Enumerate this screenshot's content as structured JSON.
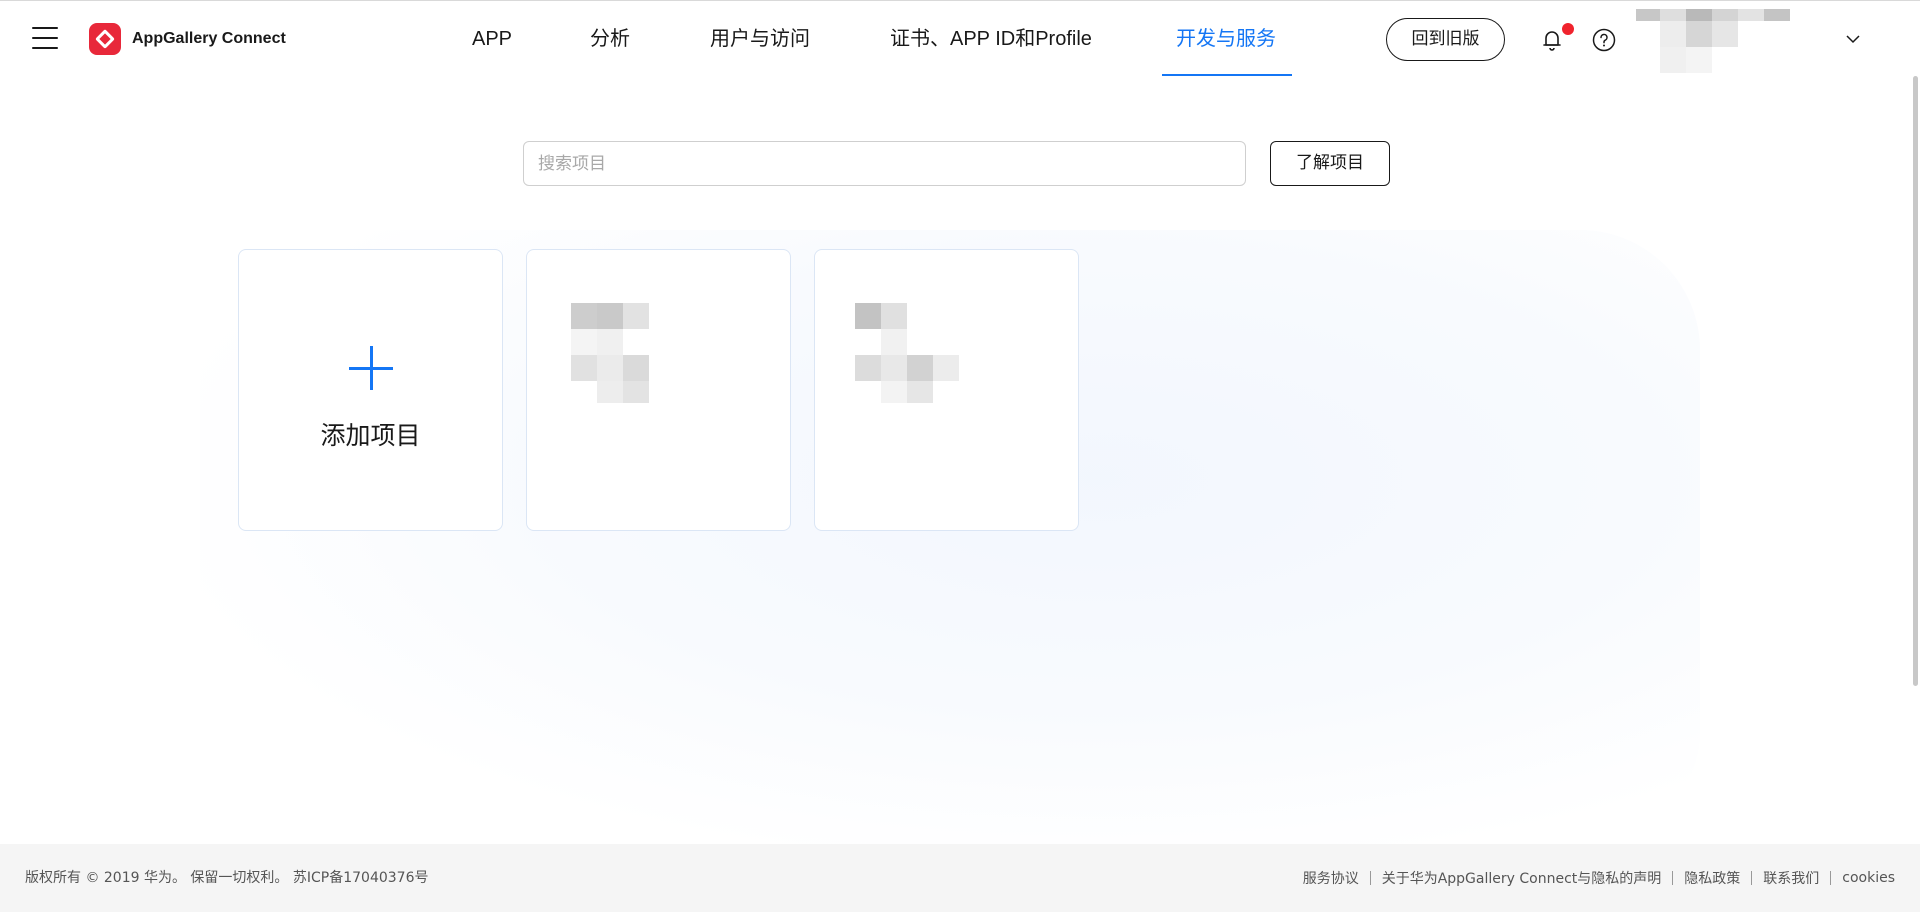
{
  "header": {
    "logo_text": "AppGallery Connect",
    "nav": [
      {
        "label": "APP"
      },
      {
        "label": "分析"
      },
      {
        "label": "用户与访问"
      },
      {
        "label": "证书、APP ID和Profile"
      },
      {
        "label": "开发与服务",
        "active": true
      }
    ],
    "old_version_label": "回到旧版",
    "notification_dot": true,
    "accent_color": "#1476f5",
    "brand_color": "#e8283a"
  },
  "main": {
    "search": {
      "placeholder": "搜索项目",
      "value": ""
    },
    "learn_button_label": "了解项目",
    "cards": [
      {
        "type": "add",
        "label": "添加项目"
      },
      {
        "type": "project",
        "label": "(pixelated)"
      },
      {
        "type": "project",
        "label": "(pixelated)"
      }
    ]
  },
  "footer": {
    "copyright": "版权所有 © 2019 华为。 保留一切权利。 苏ICP备17040376号",
    "links": [
      "服务协议",
      "关于华为AppGallery Connect与隐私的声明",
      "隐私政策",
      "联系我们",
      "cookies"
    ]
  }
}
